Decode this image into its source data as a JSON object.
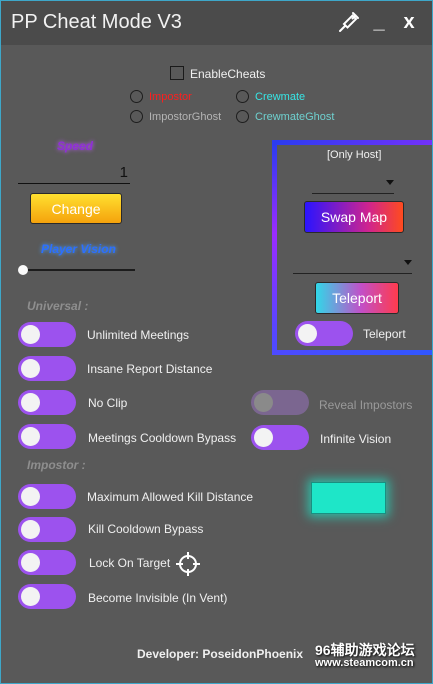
{
  "window": {
    "title": "PP Cheat Mode V3",
    "minimize_label": "_",
    "close_label": "x",
    "border_color": "#3ea7c9"
  },
  "enable_cheats": {
    "label": "EnableCheats",
    "checked": false
  },
  "roles": [
    {
      "label": "Impostor",
      "color": "#ff1e1e",
      "selected": false
    },
    {
      "label": "Crewmate",
      "color": "#37e6e6",
      "selected": false
    },
    {
      "label": "ImpostorGhost",
      "color": "#b4b4b4",
      "selected": false
    },
    {
      "label": "CrewmateGhost",
      "color": "#6fd0cf",
      "selected": false
    }
  ],
  "speed": {
    "label": "Speed",
    "value": "1",
    "button_label": "Change"
  },
  "player_vision": {
    "label": "Player Vision",
    "slider_value": 0
  },
  "host_panel": {
    "label": "[Only Host]",
    "map_value": "",
    "swap_map_label": "Swap Map",
    "teleport_value": "",
    "teleport_button_label": "Teleport",
    "teleport_toggle_label": "Teleport"
  },
  "universal": {
    "header": "Universal :",
    "left": [
      {
        "label": "Unlimited Meetings",
        "on": false
      },
      {
        "label": "Insane Report Distance",
        "on": false
      },
      {
        "label": "No Clip",
        "on": false
      },
      {
        "label": "Meetings Cooldown Bypass",
        "on": false
      }
    ],
    "reveal_impostors": {
      "label": "Reveal Impostors",
      "on": false,
      "enabled": false
    },
    "infinite_vision": {
      "label": "Infinite Vision",
      "on": false
    }
  },
  "impostor": {
    "header": "Impostor :",
    "items": [
      {
        "label": "Maximum Allowed Kill Distance",
        "on": false
      },
      {
        "label": "Kill Cooldown Bypass",
        "on": false
      },
      {
        "label": "Lock On Target",
        "on": false
      },
      {
        "label": "Become Invisible (In Vent)",
        "on": false
      }
    ],
    "color_swatch": "#1ee6c8"
  },
  "developer": "Developer: PoseidonPhoenix",
  "watermark": {
    "line1": "96辅助游戏论坛",
    "line2": "www.steamcom.cn"
  }
}
